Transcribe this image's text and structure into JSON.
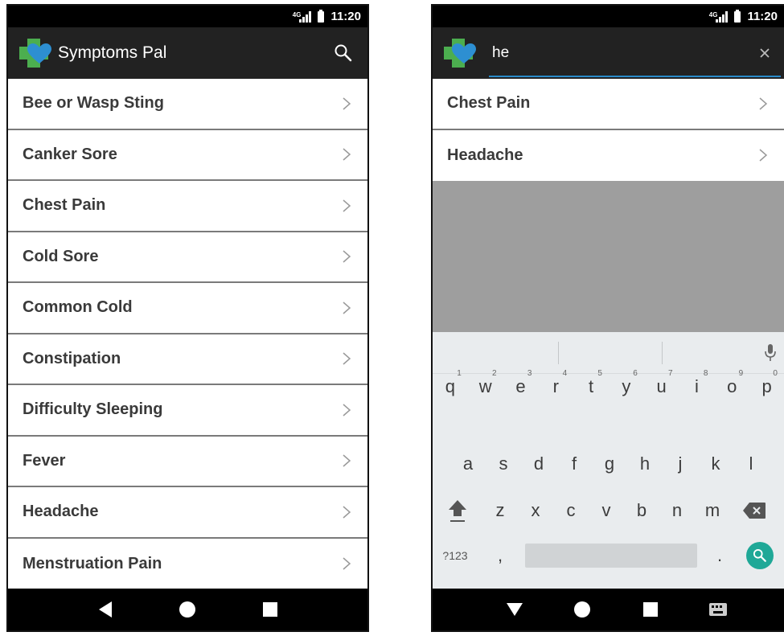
{
  "left_screen": {
    "status": {
      "time": "11:20",
      "network": "4G"
    },
    "app_title": "Symptoms Pal",
    "items": [
      {
        "label": "Bee or Wasp Sting"
      },
      {
        "label": "Canker Sore"
      },
      {
        "label": "Chest Pain"
      },
      {
        "label": "Cold Sore"
      },
      {
        "label": "Common Cold"
      },
      {
        "label": "Constipation"
      },
      {
        "label": "Difficulty Sleeping"
      },
      {
        "label": "Fever"
      },
      {
        "label": "Headache"
      },
      {
        "label": "Menstruation Pain"
      }
    ]
  },
  "right_screen": {
    "status": {
      "time": "11:20",
      "network": "4G"
    },
    "search_query": "he",
    "results": [
      {
        "label": "Chest Pain"
      },
      {
        "label": "Headache"
      }
    ],
    "keyboard": {
      "row1": [
        {
          "key": "q",
          "hint": "1"
        },
        {
          "key": "w",
          "hint": "2"
        },
        {
          "key": "e",
          "hint": "3"
        },
        {
          "key": "r",
          "hint": "4"
        },
        {
          "key": "t",
          "hint": "5"
        },
        {
          "key": "y",
          "hint": "6"
        },
        {
          "key": "u",
          "hint": "7"
        },
        {
          "key": "i",
          "hint": "8"
        },
        {
          "key": "o",
          "hint": "9"
        },
        {
          "key": "p",
          "hint": "0"
        }
      ],
      "row2": [
        "a",
        "s",
        "d",
        "f",
        "g",
        "h",
        "j",
        "k",
        "l"
      ],
      "row3": [
        "z",
        "x",
        "c",
        "v",
        "b",
        "n",
        "m"
      ],
      "symbols_label": "?123",
      "comma": ",",
      "period": "."
    }
  },
  "colors": {
    "appbar": "#222222",
    "logo_green": "#4cae4f",
    "logo_heart": "#2d8fd2",
    "search_accent": "#1fa897",
    "underline": "#2a8bc9"
  },
  "icons": {
    "search": "search-icon",
    "chevron": "chevron-right-icon",
    "close": "close-icon",
    "back": "back-icon",
    "home": "home-icon",
    "recents": "recents-icon",
    "mic": "mic-icon",
    "shift": "shift-icon",
    "backspace": "backspace-icon",
    "keyboard": "keyboard-icon"
  }
}
